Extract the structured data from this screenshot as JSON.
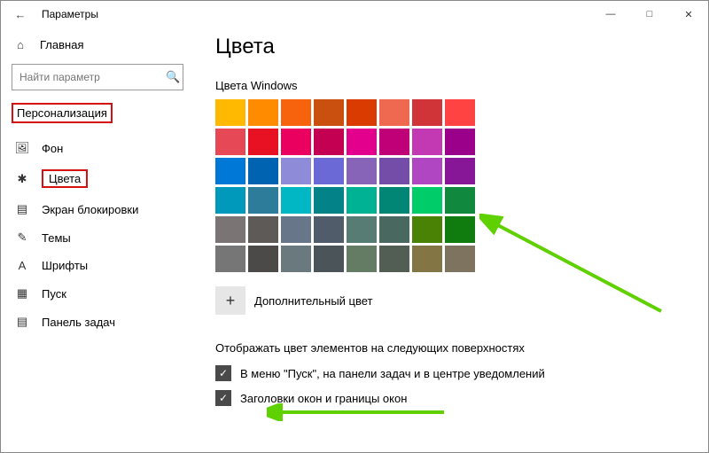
{
  "window": {
    "title": "Параметры"
  },
  "sidebar": {
    "home": "Главная",
    "search_placeholder": "Найти параметр",
    "category": "Персонализация",
    "items": [
      {
        "label": "Фон"
      },
      {
        "label": "Цвета"
      },
      {
        "label": "Экран блокировки"
      },
      {
        "label": "Темы"
      },
      {
        "label": "Шрифты"
      },
      {
        "label": "Пуск"
      },
      {
        "label": "Панель задач"
      }
    ]
  },
  "page": {
    "heading": "Цвета",
    "palette_label": "Цвета Windows",
    "add_color": "Дополнительный цвет",
    "surfaces_label": "Отображать цвет элементов на следующих поверхностях",
    "chk1": "В меню \"Пуск\", на панели задач и в центре уведомлений",
    "chk2": "Заголовки окон и границы окон"
  },
  "palette": [
    "#ffb900",
    "#ff8c00",
    "#f7630c",
    "#ca5010",
    "#da3b01",
    "#ef6950",
    "#d13438",
    "#ff4343",
    "#e74856",
    "#e81123",
    "#ea005e",
    "#c30052",
    "#e3008c",
    "#bf0077",
    "#c239b3",
    "#9a0089",
    "#0078d7",
    "#0063b1",
    "#8e8cd8",
    "#6b69d6",
    "#8764b8",
    "#744da9",
    "#b146c2",
    "#881798",
    "#0099bc",
    "#2d7d9a",
    "#00b7c3",
    "#038387",
    "#00b294",
    "#018574",
    "#00cc6a",
    "#10893e",
    "#7a7574",
    "#5d5a58",
    "#68768a",
    "#515c6b",
    "#567c73",
    "#486860",
    "#498205",
    "#107c10",
    "#767676",
    "#4c4a48",
    "#69797e",
    "#4a5459",
    "#647c64",
    "#525e54",
    "#847545",
    "#7e735f"
  ]
}
